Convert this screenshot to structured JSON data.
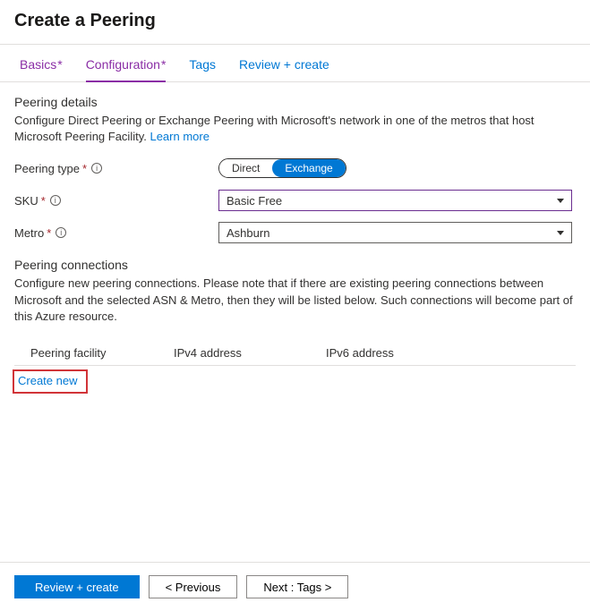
{
  "page_title": "Create a Peering",
  "tabs": {
    "basics": "Basics",
    "configuration": "Configuration",
    "tags": "Tags",
    "review": "Review + create"
  },
  "details": {
    "title": "Peering details",
    "description": "Configure Direct Peering or Exchange Peering with Microsoft's network in one of the metros that host Microsoft Peering Facility. ",
    "learn_more": "Learn more"
  },
  "form": {
    "peering_type_label": "Peering type",
    "peering_type_options": {
      "direct": "Direct",
      "exchange": "Exchange"
    },
    "sku_label": "SKU",
    "sku_value": "Basic Free",
    "metro_label": "Metro",
    "metro_value": "Ashburn"
  },
  "connections": {
    "title": "Peering connections",
    "description": "Configure new peering connections. Please note that if there are existing peering connections between Microsoft and the selected ASN & Metro, then they will be listed below. Such connections will become part of this Azure resource.",
    "columns": {
      "facility": "Peering facility",
      "ipv4": "IPv4 address",
      "ipv6": "IPv6 address"
    },
    "create_new": "Create new"
  },
  "footer": {
    "review": "Review + create",
    "previous": "< Previous",
    "next": "Next : Tags >"
  }
}
